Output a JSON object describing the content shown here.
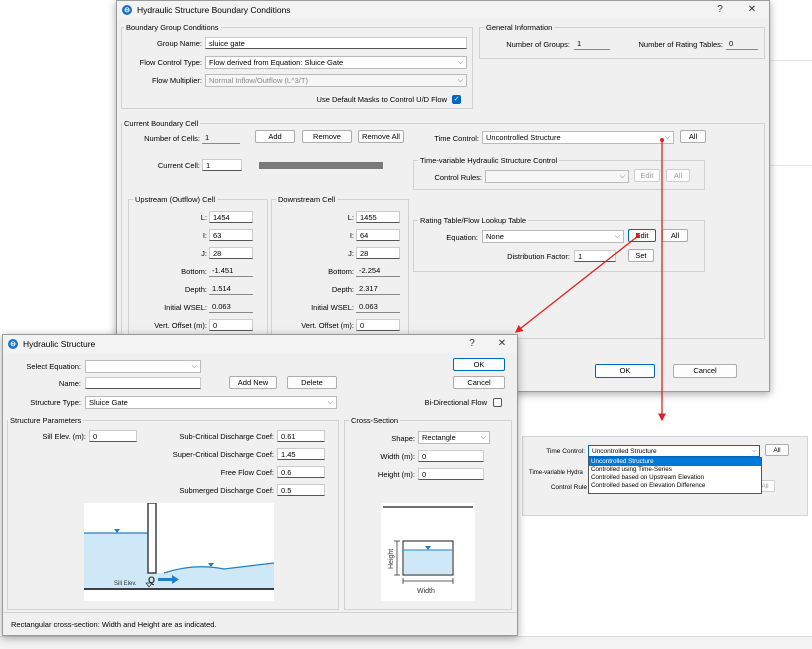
{
  "boundary_window": {
    "title": "Hydraulic Structure Boundary Conditions",
    "help": "?",
    "close": "✕",
    "boundary_group": {
      "label": "Boundary Group Conditions",
      "group_name_label": "Group Name:",
      "group_name_value": "sluice gate",
      "flow_control_type_label": "Flow Control Type:",
      "flow_control_type_value": "Flow derived from Equation: Sluice Gate",
      "flow_multiplier_label": "Flow Multiplier:",
      "flow_multiplier_value": "Normal Inflow/Outflow (L^3/T)",
      "use_default_masks_label": "Use Default Masks to Control U/D Flow"
    },
    "general_info": {
      "label": "General Information",
      "num_groups_label": "Number of Groups:",
      "num_groups_value": "1",
      "num_rating_tables_label": "Number of Rating Tables:",
      "num_rating_tables_value": "0"
    },
    "current_cell": {
      "label": "Current Boundary Cell",
      "num_cells_label": "Number of Cells:",
      "num_cells_value": "1",
      "add_label": "Add",
      "remove_label": "Remove",
      "remove_all_label": "Remove All",
      "current_cell_label": "Current Cell:",
      "current_cell_value": "1"
    },
    "time_control": {
      "label": "Time Control:",
      "value": "Uncontrolled Structure",
      "all_label": "All"
    },
    "time_variable": {
      "label": "Time-variable Hydraulic Structure Control",
      "control_rules_label": "Control Rules:",
      "control_rules_value": "",
      "edit_label": "Edit",
      "all_label": "All"
    },
    "upstream": {
      "label": "Upstream (Outflow) Cell",
      "L_label": "L:",
      "L": "1454",
      "I_label": "I:",
      "I": "63",
      "J_label": "J:",
      "J": "28",
      "bottom_label": "Bottom:",
      "bottom": "-1.451",
      "depth_label": "Depth:",
      "depth": "1.514",
      "wsel_label": "Initial WSEL:",
      "wsel": "0.063",
      "offset_label": "Vert. Offset (m):",
      "offset": "0"
    },
    "downstream": {
      "label": "Downstream Cell",
      "L_label": "L:",
      "L": "1455",
      "I_label": "I:",
      "I": "64",
      "J_label": "J:",
      "J": "28",
      "bottom_label": "Bottom:",
      "bottom": "-2.254",
      "depth_label": "Depth:",
      "depth": "2.317",
      "wsel_label": "Initial WSEL:",
      "wsel": "0.063",
      "offset_label": "Vert. Offset (m):",
      "offset": "0"
    },
    "rating_table": {
      "label": "Rating Table/Flow Lookup Table",
      "equation_label": "Equation:",
      "equation_value": "None",
      "edit_label": "Edit",
      "all_label": "All",
      "dist_factor_label": "Distribution Factor:",
      "dist_factor_value": "1",
      "set_label": "Set"
    },
    "ok_label": "OK",
    "cancel_label": "Cancel"
  },
  "structure_window": {
    "title": "Hydraulic Structure",
    "help": "?",
    "close": "✕",
    "select_equation_label": "Select Equation:",
    "select_equation_value": "",
    "name_label": "Name:",
    "name_value": "",
    "add_new_label": "Add New",
    "delete_label": "Delete",
    "structure_type_label": "Structure Type:",
    "structure_type_value": "Sluice Gate",
    "ok_label": "OK",
    "cancel_label": "Cancel",
    "bidirectional_label": "Bi-Directional Flow",
    "params": {
      "label": "Structure Parameters",
      "sill_label": "Sill Elev. (m):",
      "sill_value": "0",
      "subcrit_label": "Sub-Critical Discharge Coef:",
      "subcrit_value": "0.61",
      "supercrit_label": "Super-Critical Discharge Coef:",
      "supercrit_value": "1.45",
      "free_flow_label": "Free Flow Coef:",
      "free_flow_value": "0.6",
      "submerged_label": "Submerged Discharge Coef:",
      "submerged_value": "0.5",
      "diagram_q": "Q",
      "diagram_sill": "Sill Elev."
    },
    "cross_section": {
      "label": "Cross-Section",
      "shape_label": "Shape:",
      "shape_value": "Rectangle",
      "width_label": "Width (m):",
      "width_value": "0",
      "height_label": "Height (m):",
      "height_value": "0",
      "diagram_height": "Height",
      "diagram_width": "Width"
    },
    "status": "Rectangular cross-section: Width and Height are as indicated."
  },
  "dropdown_inset": {
    "time_control_label": "Time Control:",
    "selected_value": "Uncontrolled Structure",
    "all_label": "All",
    "time_variable_partial": "Time-variable Hydra",
    "control_rule_partial": "Control Rule",
    "options": [
      "Uncontrolled Structure",
      "Controlled using Time-Series",
      "Controlled based on Upstream Elevation",
      "Controlled based on Elevation Difference"
    ]
  },
  "colors": {
    "accent": "#0067c0",
    "annotation": "#e02020",
    "water": "#cfe8f7",
    "gate": "#404040"
  }
}
